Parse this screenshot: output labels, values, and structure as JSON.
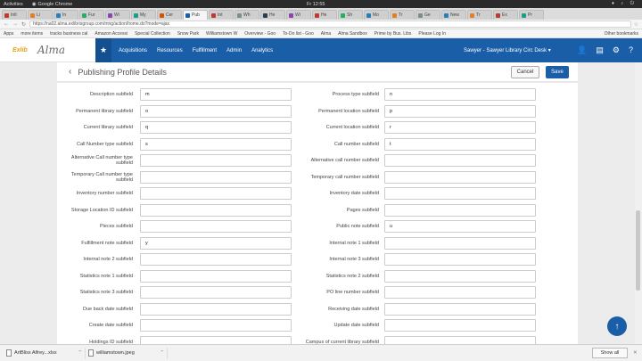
{
  "os": {
    "activities": "Activities",
    "app_name": "Google Chrome",
    "clock": "Fr 12:55",
    "sys_icons": "♦ ♪ ⏻"
  },
  "tabs": [
    {
      "label": "Intl",
      "color": "#c0392b"
    },
    {
      "label": "Li",
      "color": "#e67e22"
    },
    {
      "label": "In",
      "color": "#2980b9"
    },
    {
      "label": "Fur",
      "color": "#27ae60"
    },
    {
      "label": "Wi",
      "color": "#8e44ad"
    },
    {
      "label": "My",
      "color": "#16a085"
    },
    {
      "label": "Cer",
      "color": "#d35400"
    },
    {
      "label": "Pub",
      "color": "#1a5ea8"
    },
    {
      "label": "Int",
      "color": "#c0392b"
    },
    {
      "label": "Wh",
      "color": "#7f8c8d"
    },
    {
      "label": "He",
      "color": "#2c3e50"
    },
    {
      "label": "Wi",
      "color": "#8e44ad"
    },
    {
      "label": "He",
      "color": "#c0392b"
    },
    {
      "label": "Sh",
      "color": "#27ae60"
    },
    {
      "label": "Mo",
      "color": "#2980b9"
    },
    {
      "label": "Tr",
      "color": "#e67e22"
    },
    {
      "label": "Ge",
      "color": "#7f8c8d"
    },
    {
      "label": "New",
      "color": "#2980b9"
    },
    {
      "label": "Tr",
      "color": "#e67e22"
    },
    {
      "label": "Ex",
      "color": "#c0392b"
    },
    {
      "label": "Pr",
      "color": "#16a085"
    }
  ],
  "address": {
    "url": "https://na02.alma.exlibrisgroup.com/mng/action/home.do?mode=ajax"
  },
  "bookmarks": {
    "items": [
      "Apps",
      "more items",
      "tracks business cal",
      "Amazon Accessi",
      "Special Collection",
      "Snow Park",
      "Williamstown W",
      "Overview - Goo",
      "To-Do list - Goo",
      "Alma",
      "Alma Sandbox",
      "Prime by Bus. Libs",
      "Please Log In"
    ],
    "other": "Other bookmarks"
  },
  "app": {
    "logo_ex": "Exlib",
    "logo_alma": "Alma",
    "menu": [
      "Acquisitions",
      "Resources",
      "Fulfillment",
      "Admin",
      "Analytics"
    ],
    "user": "Sawyer - Sawyer Library Circ Desk ▾"
  },
  "page": {
    "title": "Publishing Profile Details",
    "cancel": "Cancel",
    "save": "Save"
  },
  "form": {
    "rows": [
      {
        "l_label": "Description subfield",
        "l_value": "m",
        "r_label": "Process type subfield",
        "r_value": "n"
      },
      {
        "l_label": "Permanent library subfield",
        "l_value": "o",
        "r_label": "Permanent location subfield",
        "r_value": "p"
      },
      {
        "l_label": "Current library subfield",
        "l_value": "q",
        "r_label": "Current location subfield",
        "r_value": "r"
      },
      {
        "l_label": "Call Number type subfield",
        "l_value": "s",
        "r_label": "Call number subfield",
        "r_value": "t"
      },
      {
        "l_label": "Alternative Call number type subfield",
        "l_value": "",
        "r_label": "Alternative call number subfield",
        "r_value": ""
      },
      {
        "l_label": "Temporary Call number type subfield",
        "l_value": "",
        "r_label": "Temporary call number subfield",
        "r_value": ""
      },
      {
        "l_label": "Inventory number subfield",
        "l_value": "",
        "r_label": "Inventory date subfield",
        "r_value": ""
      },
      {
        "l_label": "Storage Location ID subfield",
        "l_value": "",
        "r_label": "Pages subfield",
        "r_value": ""
      },
      {
        "l_label": "Pieces subfield",
        "l_value": "",
        "r_label": "Public note subfield",
        "r_value": "u"
      },
      {
        "l_label": "Fulfillment note subfield",
        "l_value": "y",
        "r_label": "Internal note 1 subfield",
        "r_value": ""
      },
      {
        "l_label": "Internal note 2 subfield",
        "l_value": "",
        "r_label": "Internal note 3 subfield",
        "r_value": ""
      },
      {
        "l_label": "Statistics note 1 subfield",
        "l_value": "",
        "r_label": "Statistics note 2 subfield",
        "r_value": ""
      },
      {
        "l_label": "Statistics note 3 subfield",
        "l_value": "",
        "r_label": "PO line number subfield",
        "r_value": ""
      },
      {
        "l_label": "Due back date subfield",
        "l_value": "",
        "r_label": "Receiving date subfield",
        "r_value": ""
      },
      {
        "l_label": "Create date subfield",
        "l_value": "",
        "r_label": "Update date subfield",
        "r_value": ""
      },
      {
        "l_label": "Holdings ID subfield",
        "l_value": "",
        "r_label": "Campus of current library subfield",
        "r_value": ""
      }
    ]
  },
  "downloads": {
    "files": [
      "ArtBliss Alfrey...xlsx",
      "williamstown.jpeg"
    ],
    "show_all": "Show all",
    "close": "✕"
  },
  "colors": {
    "accent": "#1a5ea8",
    "logo_ex": "#e0a21a"
  }
}
